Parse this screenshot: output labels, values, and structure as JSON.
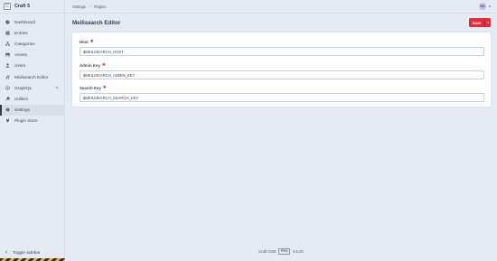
{
  "app": {
    "name": "Craft 5",
    "logo_letter": "C"
  },
  "sidebar": {
    "items": [
      {
        "label": "Dashboard",
        "icon": "gauge-icon"
      },
      {
        "label": "Entries",
        "icon": "entries-icon"
      },
      {
        "label": "Categories",
        "icon": "sitemap-icon"
      },
      {
        "label": "Assets",
        "icon": "image-icon"
      },
      {
        "label": "Users",
        "icon": "user-icon"
      },
      {
        "label": "Meilisearch Editor",
        "icon": "plugin-icon"
      },
      {
        "label": "GraphQL",
        "icon": "graphql-icon"
      },
      {
        "label": "Utilities",
        "icon": "wrench-icon"
      },
      {
        "label": "Settings",
        "icon": "gear-icon",
        "active": true
      },
      {
        "label": "Plugin Store",
        "icon": "plug-icon"
      }
    ],
    "toggle_label": "Toggle sidebar"
  },
  "header": {
    "breadcrumbs": [
      "Settings",
      "Plugins"
    ],
    "user_initials": "SO"
  },
  "page": {
    "title": "Meilisearch Editor",
    "save_label": "Save"
  },
  "form": {
    "host": {
      "label": "Host",
      "value": "$MEILISEARCH_HOST"
    },
    "admin_key": {
      "label": "Admin Key",
      "value": "$MEILISEARCH_ADMIN_KEY"
    },
    "search_key": {
      "label": "Search Key",
      "value": "$MEILISEARCH_SEARCH_KEY"
    }
  },
  "footer": {
    "product": "Craft CMS",
    "edition": "PRO",
    "version": "5.6.20"
  },
  "colors": {
    "accent": "#e12d39",
    "background": "#e4e9f2",
    "card": "#ffffff"
  }
}
